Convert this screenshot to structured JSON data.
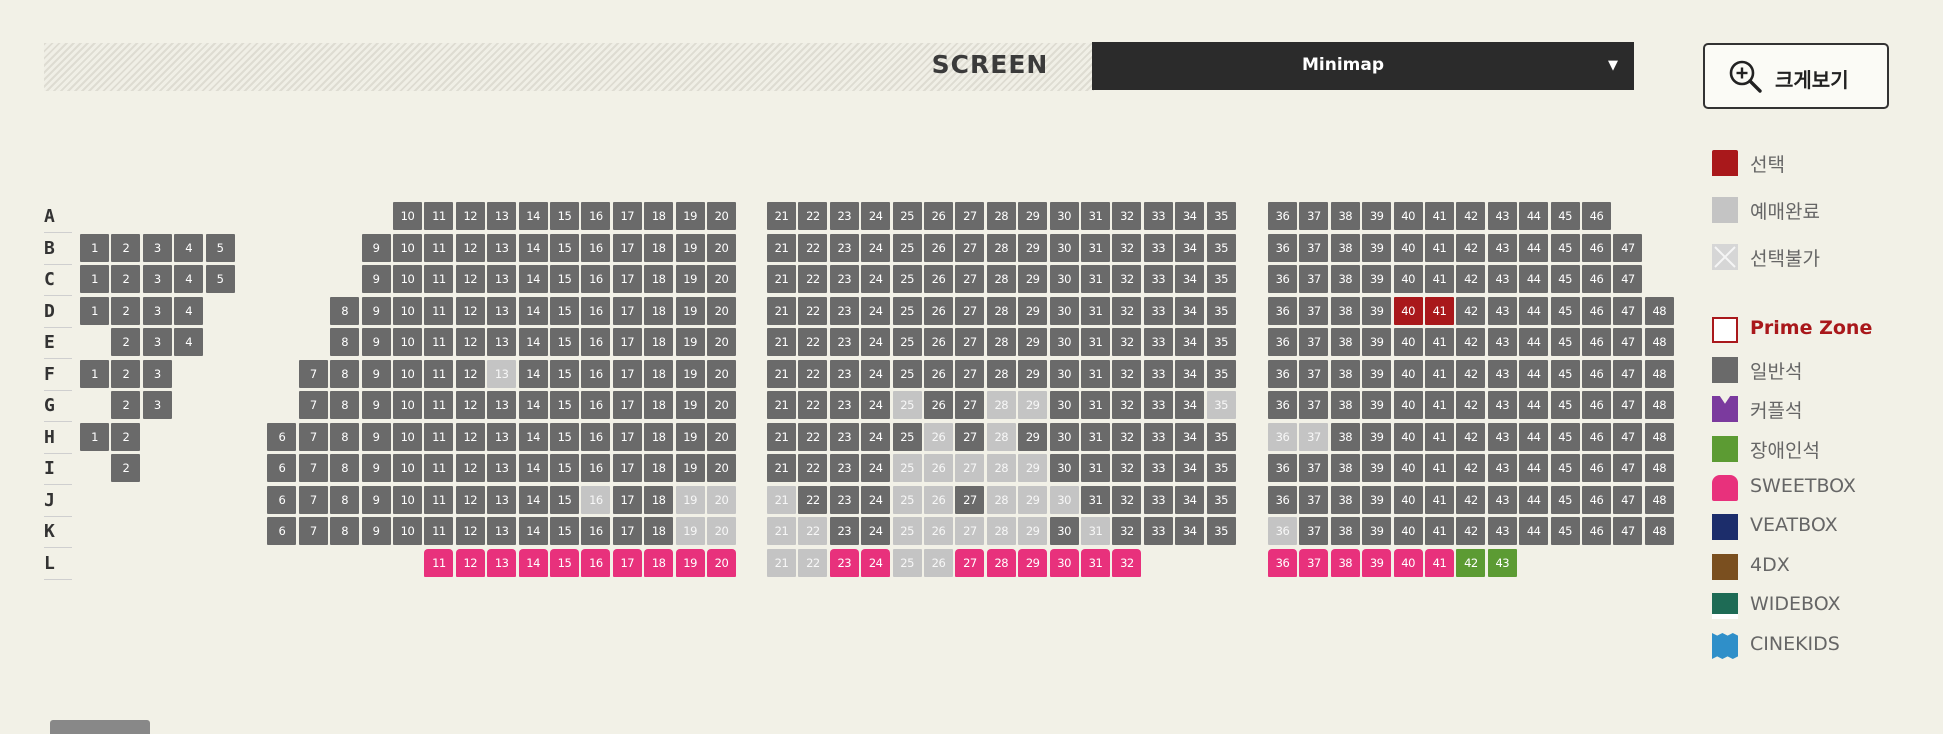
{
  "header": {
    "screen_label": "SCREEN",
    "minimap_label": "Minimap",
    "zoom_label": "크게보기"
  },
  "rows": [
    "A",
    "B",
    "C",
    "D",
    "E",
    "F",
    "G",
    "H",
    "I",
    "J",
    "K",
    "L"
  ],
  "legend": [
    {
      "key": "selected",
      "label": "선택",
      "color": "#a9181b"
    },
    {
      "key": "sold",
      "label": "예매완료",
      "color": "#c4c4c4"
    },
    {
      "key": "unavailable",
      "label": "선택불가",
      "color": "#d6d6d6"
    },
    {
      "key": "prime",
      "label": "Prime Zone",
      "color": "#a9181b"
    },
    {
      "key": "general",
      "label": "일반석",
      "color": "#6a6a6a"
    },
    {
      "key": "couple",
      "label": "커플석",
      "color": "#7b3a9e"
    },
    {
      "key": "disabled",
      "label": "장애인석",
      "color": "#5c9b33"
    },
    {
      "key": "sweetbox",
      "label": "SWEETBOX",
      "color": "#e8317c"
    },
    {
      "key": "veatbox",
      "label": "VEATBOX",
      "color": "#1c2d6b"
    },
    {
      "key": "4dx",
      "label": "4DX",
      "color": "#7a4f1f"
    },
    {
      "key": "widebox",
      "label": "WIDEBOX",
      "color": "#1e6b55"
    },
    {
      "key": "cinekids",
      "label": "CINEKIDS",
      "color": "#2f8fc9"
    }
  ],
  "seats": {
    "A": {
      "left": [],
      "c1": [
        10,
        11,
        12,
        13,
        14,
        15,
        16,
        17,
        18,
        19,
        20
      ],
      "c2": [
        21,
        22,
        23,
        24,
        25,
        26,
        27,
        28,
        29,
        30,
        31,
        32,
        33,
        34,
        35
      ],
      "c3": [
        36,
        37,
        38,
        39,
        40,
        41,
        42,
        43,
        44,
        45,
        46
      ]
    },
    "B": {
      "left": [
        1,
        2,
        3,
        4,
        5
      ],
      "c1": [
        9,
        10,
        11,
        12,
        13,
        14,
        15,
        16,
        17,
        18,
        19,
        20
      ],
      "c2": [
        21,
        22,
        23,
        24,
        25,
        26,
        27,
        28,
        29,
        30,
        31,
        32,
        33,
        34,
        35
      ],
      "c3": [
        36,
        37,
        38,
        39,
        40,
        41,
        42,
        43,
        44,
        45,
        46,
        47
      ]
    },
    "C": {
      "left": [
        1,
        2,
        3,
        4,
        5
      ],
      "c1": [
        9,
        10,
        11,
        12,
        13,
        14,
        15,
        16,
        17,
        18,
        19,
        20
      ],
      "c2": [
        21,
        22,
        23,
        24,
        25,
        26,
        27,
        28,
        29,
        30,
        31,
        32,
        33,
        34,
        35
      ],
      "c3": [
        36,
        37,
        38,
        39,
        40,
        41,
        42,
        43,
        44,
        45,
        46,
        47
      ]
    },
    "D": {
      "left": [
        1,
        2,
        3,
        4
      ],
      "c1": [
        8,
        9,
        10,
        11,
        12,
        13,
        14,
        15,
        16,
        17,
        18,
        19,
        20
      ],
      "c2": [
        21,
        22,
        23,
        24,
        25,
        26,
        27,
        28,
        29,
        30,
        31,
        32,
        33,
        34,
        35
      ],
      "c3": [
        36,
        37,
        38,
        39,
        {
          "n": 40,
          "s": "sel"
        },
        {
          "n": 41,
          "s": "sel"
        },
        42,
        43,
        44,
        45,
        46,
        47,
        48
      ]
    },
    "E": {
      "left": [
        2,
        3,
        4
      ],
      "c1": [
        8,
        9,
        10,
        11,
        12,
        13,
        14,
        15,
        16,
        17,
        18,
        19,
        20
      ],
      "c2": [
        21,
        22,
        23,
        24,
        25,
        26,
        27,
        28,
        29,
        30,
        31,
        32,
        33,
        34,
        35
      ],
      "c3": [
        36,
        37,
        38,
        39,
        40,
        41,
        42,
        43,
        44,
        45,
        46,
        47,
        48
      ]
    },
    "F": {
      "left": [
        1,
        2,
        3
      ],
      "c1": [
        7,
        8,
        9,
        10,
        11,
        12,
        {
          "n": 13,
          "s": "done"
        },
        14,
        15,
        16,
        17,
        18,
        19,
        20
      ],
      "c2": [
        21,
        22,
        23,
        24,
        25,
        26,
        27,
        28,
        29,
        30,
        31,
        32,
        33,
        34,
        35
      ],
      "c3": [
        36,
        37,
        38,
        39,
        40,
        41,
        42,
        43,
        44,
        45,
        46,
        47,
        48
      ]
    },
    "G": {
      "left": [
        2,
        3
      ],
      "c1": [
        7,
        8,
        9,
        10,
        11,
        12,
        13,
        14,
        15,
        16,
        17,
        18,
        19,
        20
      ],
      "c2": [
        21,
        22,
        23,
        24,
        {
          "n": 25,
          "s": "done"
        },
        26,
        27,
        {
          "n": 28,
          "s": "done"
        },
        {
          "n": 29,
          "s": "done"
        },
        30,
        31,
        32,
        33,
        34,
        {
          "n": 35,
          "s": "done"
        }
      ],
      "c3": [
        36,
        37,
        38,
        39,
        40,
        41,
        42,
        43,
        44,
        45,
        46,
        47,
        48
      ]
    },
    "H": {
      "left": [
        1,
        2
      ],
      "c1": [
        6,
        7,
        8,
        9,
        10,
        11,
        12,
        13,
        14,
        15,
        16,
        17,
        18,
        19,
        20
      ],
      "c2": [
        21,
        22,
        23,
        24,
        25,
        {
          "n": 26,
          "s": "done"
        },
        27,
        {
          "n": 28,
          "s": "done"
        },
        29,
        30,
        31,
        32,
        33,
        34,
        35
      ],
      "c3": [
        {
          "n": 36,
          "s": "done"
        },
        {
          "n": 37,
          "s": "done"
        },
        38,
        39,
        40,
        41,
        42,
        43,
        44,
        45,
        46,
        47,
        48
      ]
    },
    "I": {
      "left": [
        2
      ],
      "c1": [
        6,
        7,
        8,
        9,
        10,
        11,
        12,
        13,
        14,
        15,
        16,
        17,
        18,
        19,
        20
      ],
      "c2": [
        21,
        22,
        23,
        24,
        {
          "n": 25,
          "s": "done"
        },
        {
          "n": 26,
          "s": "done"
        },
        {
          "n": 27,
          "s": "done"
        },
        {
          "n": 28,
          "s": "done"
        },
        {
          "n": 29,
          "s": "done"
        },
        30,
        31,
        32,
        33,
        34,
        35
      ],
      "c3": [
        36,
        37,
        38,
        39,
        40,
        41,
        42,
        43,
        44,
        45,
        46,
        47,
        48
      ]
    },
    "J": {
      "left": [],
      "c1": [
        6,
        7,
        8,
        9,
        10,
        11,
        12,
        13,
        14,
        15,
        {
          "n": 16,
          "s": "done"
        },
        17,
        18,
        {
          "n": 19,
          "s": "done"
        },
        {
          "n": 20,
          "s": "done"
        }
      ],
      "c2": [
        {
          "n": 21,
          "s": "done"
        },
        22,
        23,
        24,
        {
          "n": 25,
          "s": "done"
        },
        {
          "n": 26,
          "s": "done"
        },
        27,
        {
          "n": 28,
          "s": "done"
        },
        {
          "n": 29,
          "s": "done"
        },
        {
          "n": 30,
          "s": "done"
        },
        31,
        32,
        33,
        34,
        35
      ],
      "c3": [
        36,
        37,
        38,
        39,
        40,
        41,
        42,
        43,
        44,
        45,
        46,
        47,
        48
      ]
    },
    "K": {
      "left": [],
      "c1": [
        6,
        7,
        8,
        9,
        10,
        11,
        12,
        13,
        14,
        15,
        16,
        17,
        18,
        {
          "n": 19,
          "s": "done"
        },
        {
          "n": 20,
          "s": "done"
        }
      ],
      "c2": [
        {
          "n": 21,
          "s": "done"
        },
        {
          "n": 22,
          "s": "done"
        },
        23,
        24,
        {
          "n": 25,
          "s": "done"
        },
        {
          "n": 26,
          "s": "done"
        },
        {
          "n": 27,
          "s": "done"
        },
        {
          "n": 28,
          "s": "done"
        },
        {
          "n": 29,
          "s": "done"
        },
        30,
        {
          "n": 31,
          "s": "done"
        },
        32,
        33,
        34,
        35
      ],
      "c3": [
        {
          "n": 36,
          "s": "done"
        },
        37,
        38,
        39,
        40,
        41,
        42,
        43,
        44,
        45,
        46,
        47,
        48
      ]
    },
    "L": {
      "left": [],
      "c1": [
        {
          "n": 11,
          "s": "sweet"
        },
        {
          "n": 12,
          "s": "sweet"
        },
        {
          "n": 13,
          "s": "sweet"
        },
        {
          "n": 14,
          "s": "sweet"
        },
        {
          "n": 15,
          "s": "sweet"
        },
        {
          "n": 16,
          "s": "sweet"
        },
        {
          "n": 17,
          "s": "sweet"
        },
        {
          "n": 18,
          "s": "sweet"
        },
        {
          "n": 19,
          "s": "sweet"
        },
        {
          "n": 20,
          "s": "sweet"
        }
      ],
      "c2": [
        {
          "n": 21,
          "s": "done"
        },
        {
          "n": 22,
          "s": "done"
        },
        {
          "n": 23,
          "s": "sweet"
        },
        {
          "n": 24,
          "s": "sweet"
        },
        {
          "n": 25,
          "s": "done"
        },
        {
          "n": 26,
          "s": "done"
        },
        {
          "n": 27,
          "s": "sweet"
        },
        {
          "n": 28,
          "s": "sweet"
        },
        {
          "n": 29,
          "s": "sweet"
        },
        {
          "n": 30,
          "s": "sweet"
        },
        {
          "n": 31,
          "s": "sweet"
        },
        {
          "n": 32,
          "s": "sweet"
        }
      ],
      "c3": [
        {
          "n": 36,
          "s": "sweet"
        },
        {
          "n": 37,
          "s": "sweet"
        },
        {
          "n": 38,
          "s": "sweet"
        },
        {
          "n": 39,
          "s": "sweet"
        },
        {
          "n": 40,
          "s": "sweet"
        },
        {
          "n": 41,
          "s": "sweet"
        },
        {
          "n": 42,
          "s": "dis"
        },
        {
          "n": 43,
          "s": "dis"
        }
      ]
    }
  }
}
